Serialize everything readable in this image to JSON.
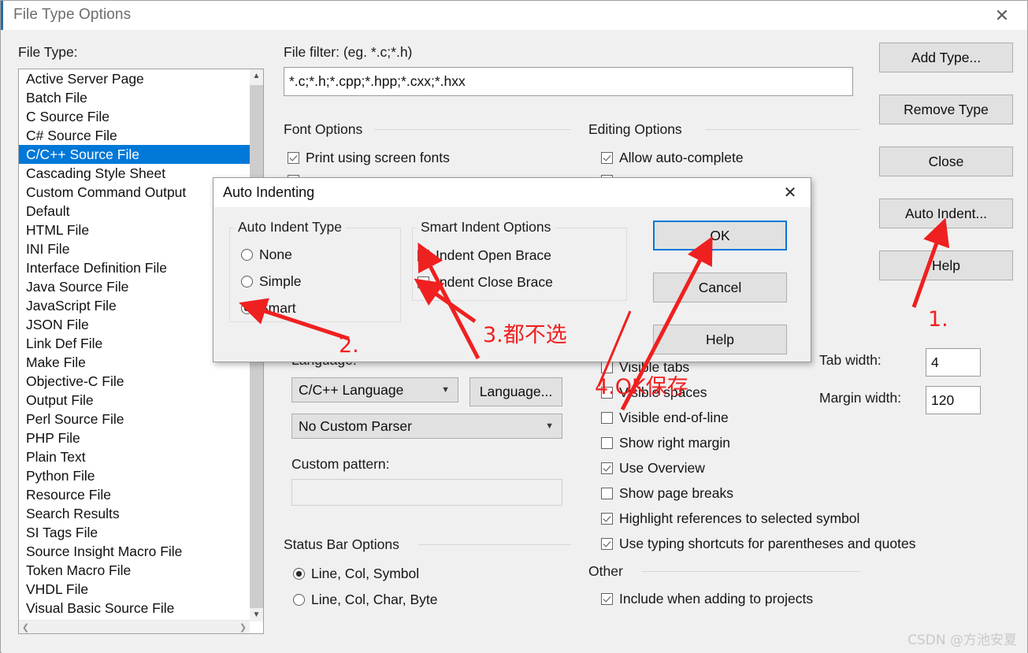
{
  "window": {
    "title": "File Type Options",
    "close_icon": "close-icon"
  },
  "file_type": {
    "label": "File Type:",
    "selected": "C/C++ Source File",
    "items": [
      "Active Server Page",
      "Batch File",
      "C Source File",
      "C# Source File",
      "C/C++ Source File",
      "Cascading Style Sheet",
      "Custom Command Output",
      "Default",
      "HTML File",
      "INI File",
      "Interface Definition File",
      "Java Source File",
      "JavaScript File",
      "JSON File",
      "Link Def File",
      "Make File",
      "Objective-C File",
      "Output File",
      "Perl Source File",
      "PHP File",
      "Plain Text",
      "Python File",
      "Resource File",
      "Search Results",
      "SI Tags File",
      "Source Insight Macro File",
      "Token Macro File",
      "VHDL File",
      "Visual Basic Source File"
    ],
    "scroll_up_icon": "chevron-up-icon",
    "scroll_down_icon": "chevron-down-icon",
    "scroll_left_icon": "chevron-left-icon",
    "scroll_right_icon": "chevron-right-icon"
  },
  "file_filter": {
    "label": "File filter: (eg. *.c;*.h)",
    "value": "*.c;*.h;*.cpp;*.hpp;*.cxx;*.hxx"
  },
  "font_options": {
    "title": "Font Options",
    "print_using_screen_fonts": {
      "label": "Print using screen fonts",
      "checked": true
    }
  },
  "editing_options": {
    "title": "Editing Options",
    "allow_auto_complete": {
      "label": "Allow auto-complete",
      "checked": true
    },
    "items": [
      {
        "label": "Visible tabs",
        "checked": false
      },
      {
        "label": "Visible spaces",
        "checked": false
      },
      {
        "label": "Visible end-of-line",
        "checked": false
      },
      {
        "label": "Show right margin",
        "checked": false
      },
      {
        "label": "Use Overview",
        "checked": true
      },
      {
        "label": "Show page breaks",
        "checked": false
      },
      {
        "label": "Highlight references to selected symbol",
        "checked": true
      },
      {
        "label": "Use typing shortcuts for parentheses and quotes",
        "checked": true
      }
    ]
  },
  "other": {
    "title": "Other",
    "include_when_adding": {
      "label": "Include when adding to projects",
      "checked": true
    }
  },
  "language_section": {
    "label": "Language:",
    "selected": "C/C++ Language",
    "button": "Language...",
    "parser_selected": "No Custom Parser",
    "custom_pattern_label": "Custom pattern:",
    "custom_pattern_value": "",
    "chevron_icon": "chevron-down-icon"
  },
  "status_bar_options": {
    "title": "Status Bar Options",
    "options": [
      {
        "label": "Line, Col, Symbol",
        "selected": true
      },
      {
        "label": "Line, Col, Char, Byte",
        "selected": false
      }
    ]
  },
  "widths": {
    "tab_width_label": "Tab width:",
    "tab_width_value": "4",
    "margin_width_label": "Margin width:",
    "margin_width_value": "120"
  },
  "side_buttons": [
    {
      "label": "Add Type...",
      "name": "add-type-button"
    },
    {
      "label": "Remove Type",
      "name": "remove-type-button"
    },
    {
      "label": "Close",
      "name": "close-button"
    },
    {
      "label": "Auto Indent...",
      "name": "auto-indent-button"
    },
    {
      "label": "Help",
      "name": "help-button"
    }
  ],
  "dialog": {
    "title": "Auto Indenting",
    "close_icon": "close-icon",
    "auto_indent_type": {
      "title": "Auto Indent Type",
      "options": [
        {
          "label": "None",
          "selected": false
        },
        {
          "label": "Simple",
          "selected": false
        },
        {
          "label": "Smart",
          "selected": true
        }
      ]
    },
    "smart_indent_options": {
      "title": "Smart Indent Options",
      "options": [
        {
          "label": "Indent Open Brace",
          "checked": false
        },
        {
          "label": "Indent Close Brace",
          "checked": false
        }
      ]
    },
    "buttons": [
      {
        "label": "OK",
        "name": "dialog-ok-button",
        "default": true
      },
      {
        "label": "Cancel",
        "name": "dialog-cancel-button",
        "default": false
      },
      {
        "label": "Help",
        "name": "dialog-help-button",
        "default": false
      }
    ]
  },
  "annotations": [
    {
      "text": "1.",
      "name": "annotation-step-1"
    },
    {
      "text": "2.",
      "name": "annotation-step-2"
    },
    {
      "text": "3.都不选",
      "name": "annotation-step-3"
    },
    {
      "text": "4.OK保存",
      "name": "annotation-step-4"
    }
  ],
  "watermark": "CSDN @方池安夏",
  "colors": {
    "accent": "#0078d7",
    "annotation": "#ef2020",
    "window_bg": "#f0f0f0"
  }
}
